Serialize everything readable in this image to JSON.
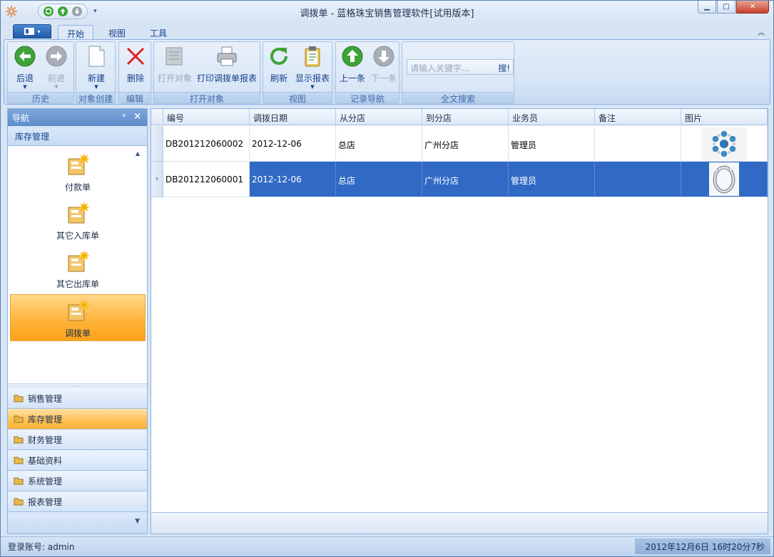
{
  "window": {
    "title": "调拨单 - 蓝格珠宝销售管理软件[试用版本]",
    "controls": {
      "minimize": "▁",
      "maximize": "□",
      "close": "✕"
    }
  },
  "ribbon_tabs": [
    "开始",
    "视图",
    "工具"
  ],
  "ribbon": {
    "history": {
      "caption": "历史",
      "back": "后退",
      "forward": "前进"
    },
    "create": {
      "caption": "对象创建",
      "new": "新建"
    },
    "edit": {
      "caption": "编辑",
      "delete": "删除"
    },
    "open": {
      "caption": "打开对象",
      "open_object": "打开对象",
      "print": "打印调拨单报表"
    },
    "view": {
      "caption": "视图",
      "refresh": "刷新",
      "show_report": "显示报表"
    },
    "record_nav": {
      "caption": "记录导航",
      "prev": "上一条",
      "next": "下一条"
    },
    "fulltext": {
      "caption": "全文搜索",
      "placeholder": "请输入关键字...",
      "search_button": "搜!"
    }
  },
  "nav": {
    "header": "导航",
    "category": "库存管理",
    "items": [
      {
        "label": "付款单",
        "selected": false
      },
      {
        "label": "其它入库单",
        "selected": false
      },
      {
        "label": "其它出库单",
        "selected": false
      },
      {
        "label": "调拨单",
        "selected": true
      }
    ],
    "groups": [
      {
        "label": "销售管理",
        "active": false
      },
      {
        "label": "库存管理",
        "active": true
      },
      {
        "label": "财务管理",
        "active": false
      },
      {
        "label": "基础资料",
        "active": false
      },
      {
        "label": "系统管理",
        "active": false
      },
      {
        "label": "报表管理",
        "active": false
      }
    ]
  },
  "grid": {
    "columns": [
      "编号",
      "调拨日期",
      "从分店",
      "到分店",
      "业务员",
      "备注",
      "图片"
    ],
    "rows": [
      {
        "id": "DB201212060002",
        "date": "2012-12-06",
        "from": "总店",
        "to": "广州分店",
        "clerk": "管理员",
        "note": "",
        "picture": "brooch",
        "selected": false
      },
      {
        "id": "DB201212060001",
        "date": "2012-12-06",
        "from": "总店",
        "to": "广州分店",
        "clerk": "管理员",
        "note": "",
        "picture": "ring",
        "selected": true
      }
    ]
  },
  "status": {
    "account": "登录账号: admin",
    "datetime": "2012年12月6日 16时20分7秒"
  },
  "colors": {
    "selection": "#316ac5",
    "nav_selected": "#ffb43c"
  }
}
